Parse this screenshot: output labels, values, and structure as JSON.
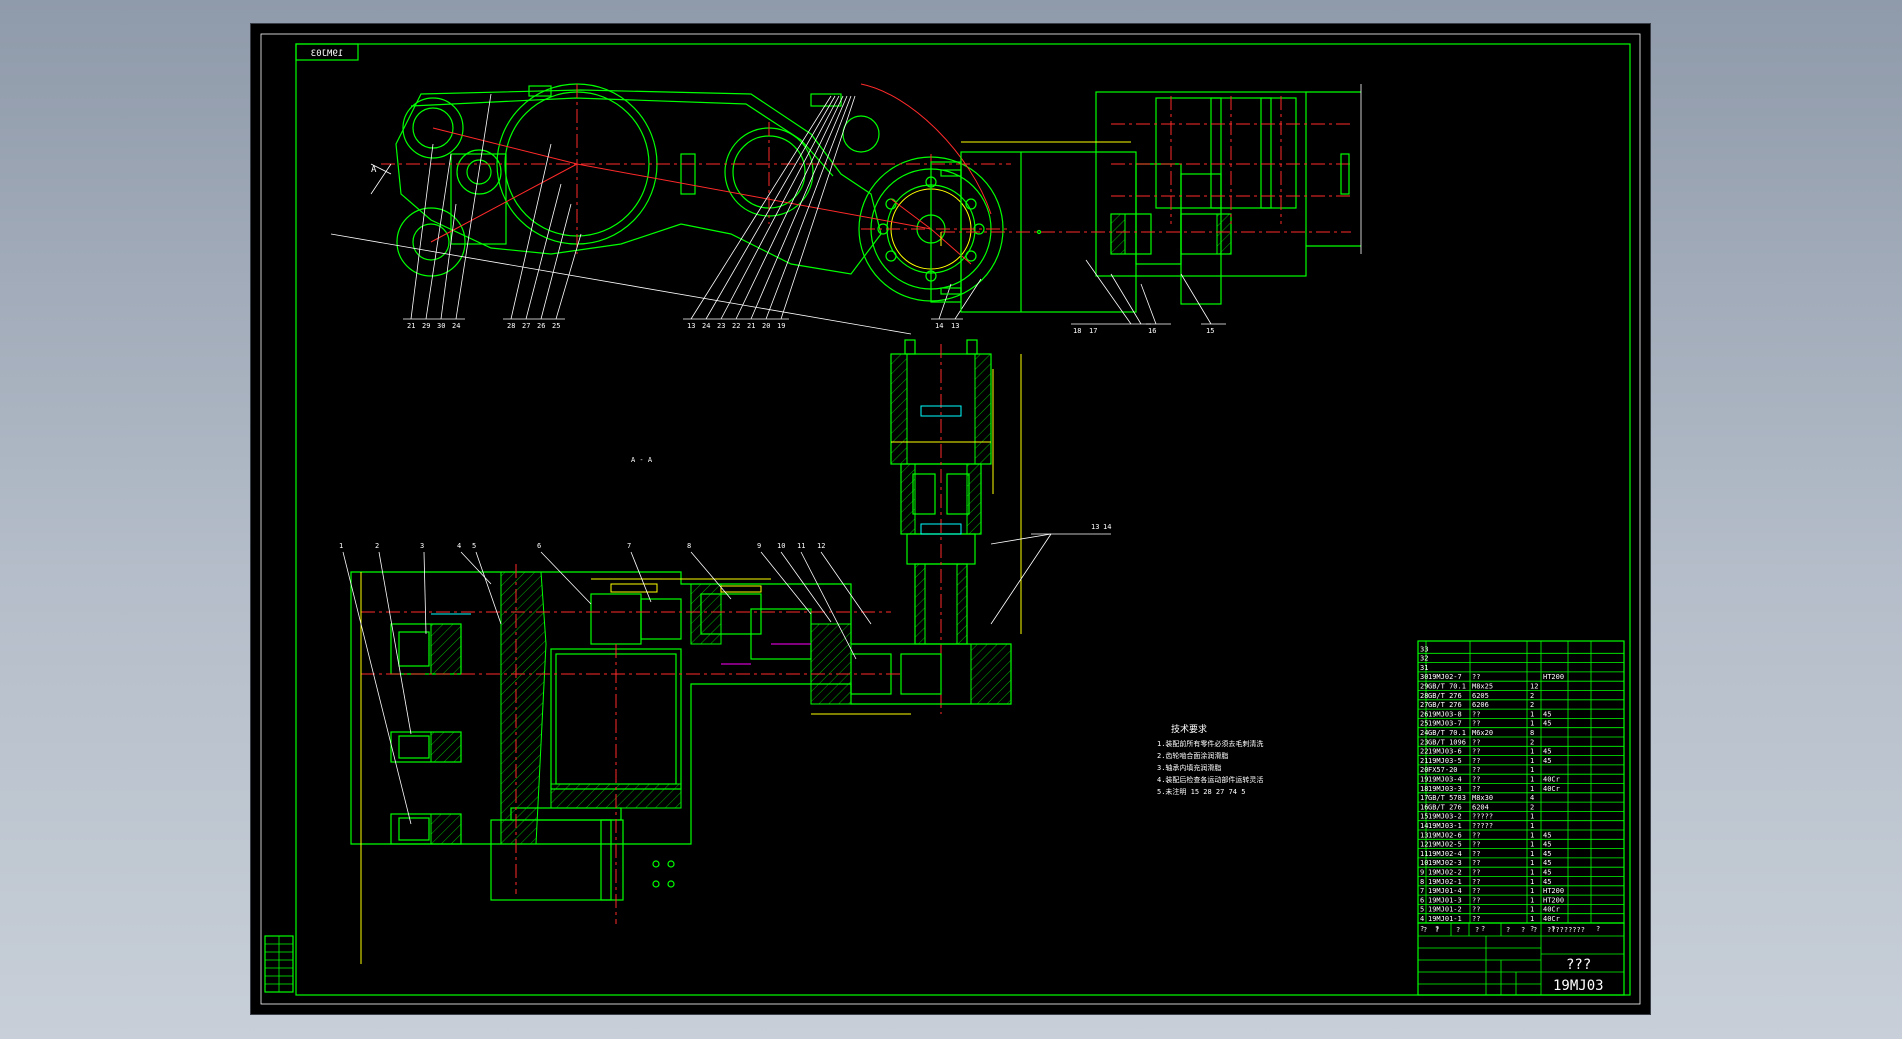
{
  "drawing": {
    "code": "19MJ03",
    "code_mirrored": "19MJ03",
    "section_label": "A - A",
    "view_arrow_label": "A",
    "tech_requirements_title": "技术要求",
    "tech_requirements": [
      "1.装配前所有零件必须去毛刺清洗",
      "2.齿轮啮合面涂润滑脂",
      "3.轴承内填充润滑脂",
      "4.装配后检查各运动部件运转灵活",
      "5.未注明 15 28 27 74 5"
    ],
    "title_block": {
      "name_placeholder": "???",
      "drawing_no": "19MJ03",
      "school_placeholder": "?????????"
    },
    "callouts_top": [
      "21",
      "29",
      "30",
      "24",
      "28",
      "27",
      "26",
      "25",
      "13",
      "24",
      "23",
      "22",
      "21",
      "20",
      "19",
      "14",
      "13"
    ],
    "callouts_side": [
      "18",
      "17",
      "16",
      "15"
    ],
    "callouts_bottom": [
      "1",
      "2",
      "3",
      "4",
      "5",
      "6",
      "7",
      "8",
      "9",
      "10",
      "11",
      "12",
      "13",
      "14"
    ],
    "bom_rows": [
      {
        "no": "33",
        "code": "",
        "name": "",
        "qty": "",
        "mat": ""
      },
      {
        "no": "32",
        "code": "",
        "name": "",
        "qty": "",
        "mat": ""
      },
      {
        "no": "31",
        "code": "",
        "name": "",
        "qty": "",
        "mat": ""
      },
      {
        "no": "30",
        "code": "19MJ02-7",
        "name": "??",
        "qty": "",
        "mat": "HT200"
      },
      {
        "no": "29",
        "code": "GB/T 70.1",
        "name": "M8x25",
        "qty": "12",
        "mat": ""
      },
      {
        "no": "28",
        "code": "GB/T 276",
        "name": "6205",
        "qty": "2",
        "mat": ""
      },
      {
        "no": "27",
        "code": "GB/T 276",
        "name": "6206",
        "qty": "2",
        "mat": ""
      },
      {
        "no": "26",
        "code": "19MJ03-8",
        "name": "??",
        "qty": "1",
        "mat": "45"
      },
      {
        "no": "25",
        "code": "19MJ03-7",
        "name": "??",
        "qty": "1",
        "mat": "45"
      },
      {
        "no": "24",
        "code": "GB/T 70.1",
        "name": "M6x20",
        "qty": "8",
        "mat": ""
      },
      {
        "no": "23",
        "code": "GB/T 1096",
        "name": "??",
        "qty": "2",
        "mat": ""
      },
      {
        "no": "22",
        "code": "19MJ03-6",
        "name": "??",
        "qty": "1",
        "mat": "45"
      },
      {
        "no": "21",
        "code": "19MJ03-5",
        "name": "??",
        "qty": "1",
        "mat": "45"
      },
      {
        "no": "20",
        "code": "FX57-20",
        "name": "??",
        "qty": "1",
        "mat": ""
      },
      {
        "no": "19",
        "code": "19MJ03-4",
        "name": "??",
        "qty": "1",
        "mat": "40Cr"
      },
      {
        "no": "18",
        "code": "19MJ03-3",
        "name": "??",
        "qty": "1",
        "mat": "40Cr"
      },
      {
        "no": "17",
        "code": "GB/T 5783",
        "name": "M8x30",
        "qty": "4",
        "mat": ""
      },
      {
        "no": "16",
        "code": "GB/T 276",
        "name": "6204",
        "qty": "2",
        "mat": ""
      },
      {
        "no": "15",
        "code": "19MJ03-2",
        "name": "?????",
        "qty": "1",
        "mat": ""
      },
      {
        "no": "14",
        "code": "19MJ03-1",
        "name": "?????",
        "qty": "1",
        "mat": ""
      },
      {
        "no": "13",
        "code": "19MJ02-6",
        "name": "??",
        "qty": "1",
        "mat": "45"
      },
      {
        "no": "12",
        "code": "19MJ02-5",
        "name": "??",
        "qty": "1",
        "mat": "45"
      },
      {
        "no": "11",
        "code": "19MJ02-4",
        "name": "??",
        "qty": "1",
        "mat": "45"
      },
      {
        "no": "10",
        "code": "19MJ02-3",
        "name": "??",
        "qty": "1",
        "mat": "45"
      },
      {
        "no": "9",
        "code": "19MJ02-2",
        "name": "??",
        "qty": "1",
        "mat": "45"
      },
      {
        "no": "8",
        "code": "19MJ02-1",
        "name": "??",
        "qty": "1",
        "mat": "45"
      },
      {
        "no": "7",
        "code": "19MJ01-4",
        "name": "??",
        "qty": "1",
        "mat": "HT200"
      },
      {
        "no": "6",
        "code": "19MJ01-3",
        "name": "??",
        "qty": "1",
        "mat": "HT200"
      },
      {
        "no": "5",
        "code": "19MJ01-2",
        "name": "??",
        "qty": "1",
        "mat": "40Cr"
      },
      {
        "no": "4",
        "code": "19MJ01-1",
        "name": "??",
        "qty": "1",
        "mat": "40Cr"
      }
    ],
    "bom_header": [
      "?",
      "?",
      "?",
      "?",
      "?",
      "?"
    ],
    "revision_cells": [
      "?",
      "?",
      "?",
      "?",
      "?",
      "?",
      "?"
    ]
  },
  "colors": {
    "line_main": "#00ff00",
    "center_line": "#ff2a2a",
    "dimension": "#ffff00",
    "annotation": "#ffffff",
    "background": "#000000"
  }
}
